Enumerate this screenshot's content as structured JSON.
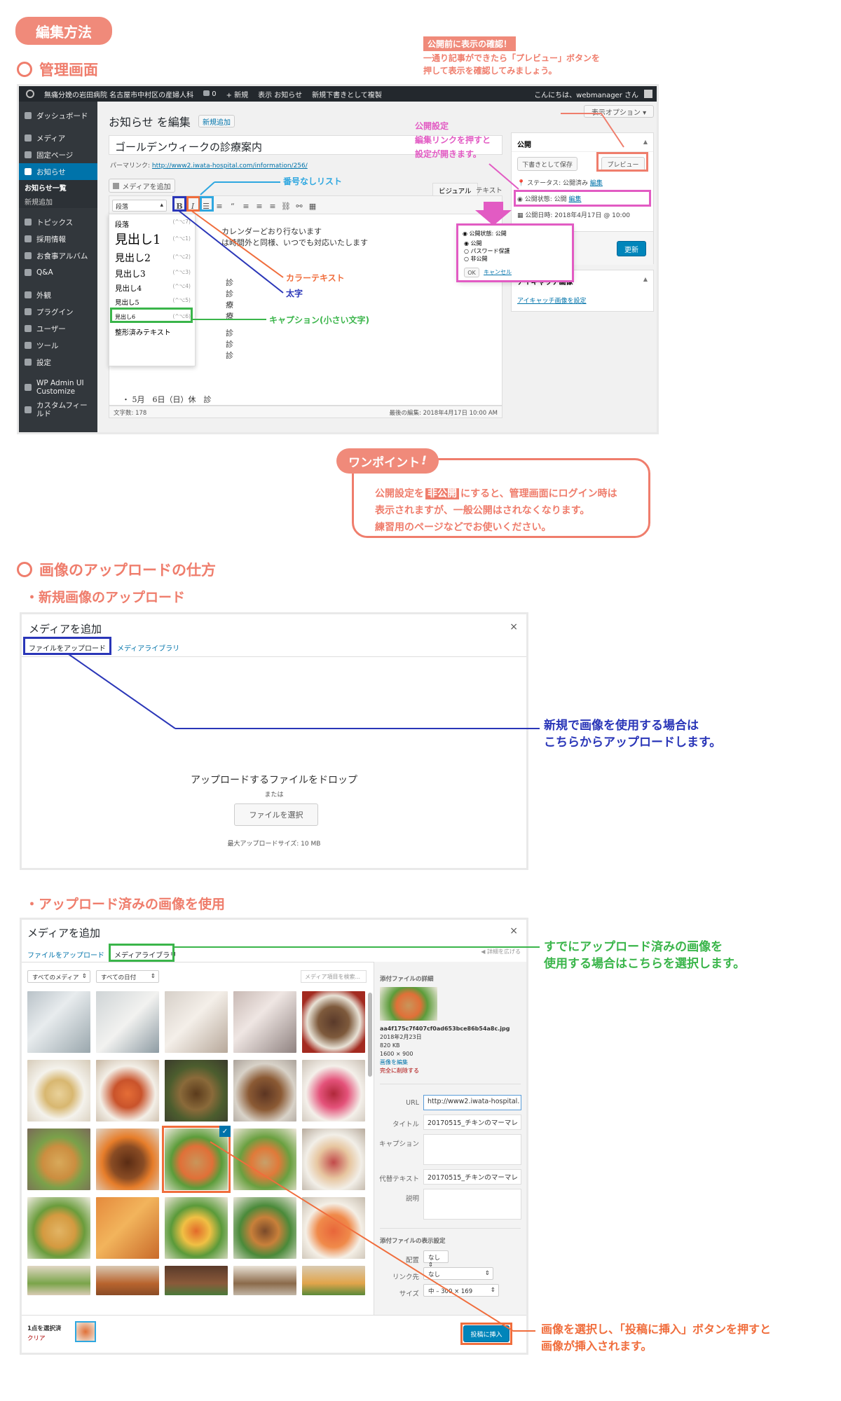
{
  "header": {
    "pill": "編集方法",
    "section1": "管理画面",
    "section2": "画像のアップロードの仕方",
    "sub1": "・新規画像のアップロード",
    "sub2": "・アップロード済みの画像を使用"
  },
  "notes": {
    "preview_title": "公開前に表示の確認！",
    "preview_body_1": "一通り記事ができたら「プレビュー」ボタンを",
    "preview_body_2": "押して表示を確認してみましょう。",
    "publish_1": "公開設定",
    "publish_2": "編集リンクを押すと",
    "publish_3": "設定が開きます。",
    "bullet_list": "番号なしリスト",
    "color_text": "カラーテキスト",
    "bold": "太字",
    "caption": "キャプション(小さい文字)",
    "onepoint_title": "ワンポイント",
    "onepoint_1a": "公開設定を",
    "onepoint_1b": "非公開",
    "onepoint_1c": "にすると、管理画面にログイン時は",
    "onepoint_2": "表示されますが、一般公開はされなくなります。",
    "onepoint_3": "練習用のページなどでお使いください。",
    "upload_note_1": "新規で画像を使用する場合は",
    "upload_note_2": "こちらからアップロードします。",
    "library_note_1": "すでにアップロード済みの画像を",
    "library_note_2": "使用する場合はこちらを選択します。",
    "insert_note_1": "画像を選択し、「投稿に挿入」ボタンを押すと",
    "insert_note_2": "画像が挿入されます。"
  },
  "admin": {
    "adminbar": {
      "site": "無痛分娩の岩田病院 名古屋市中村区の産婦人科",
      "comments": "0",
      "new": "+ 新規",
      "view": "表示 お知らせ",
      "draft": "新規下書きとして複製",
      "greeting": "こんにちは、webmanager さん"
    },
    "sidebar": [
      "ダッシュボード",
      "メディア",
      "固定ページ",
      "お知らせ",
      "お知らせ一覧",
      "新規追加",
      "トピックス",
      "採用情報",
      "お食事アルバム",
      "Q&A",
      "外観",
      "プラグイン",
      "ユーザー",
      "ツール",
      "設定",
      "WP Admin UI Customize",
      "カスタムフィールド"
    ],
    "screen_options": "表示オプション ▾",
    "page_title": "お知らせ を編集",
    "add_new": "新規追加",
    "post_title": "ゴールデンウィークの診療案内",
    "permalink_label": "パーマリンク:",
    "permalink_url": "http://www2.iwata-hospital.com/information/256/",
    "add_media": "メディアを追加",
    "tab_visual": "ビジュアル",
    "tab_text": "テキスト",
    "format_select": "段落",
    "format_items": [
      {
        "label": "段落",
        "key": "(^⌥7)"
      },
      {
        "label": "見出し1",
        "key": "(^⌥1)"
      },
      {
        "label": "見出し2",
        "key": "(^⌥2)"
      },
      {
        "label": "見出し3",
        "key": "(^⌥3)"
      },
      {
        "label": "見出し4",
        "key": "(^⌥4)"
      },
      {
        "label": "見出し5",
        "key": "(^⌥5)"
      },
      {
        "label": "見出し6",
        "key": "(^⌥6)"
      },
      {
        "label": "整形済みテキスト",
        "key": ""
      }
    ],
    "content_1": "カレンダーどおり行ないます",
    "content_2": "は時間外と同様、いつでも対応いたします",
    "content_last": "・ 5月　6日（日）休　診",
    "content_frag": [
      "診",
      "診",
      "療",
      "療",
      "診",
      "診",
      "診"
    ],
    "word_count": "文字数: 178",
    "last_edit": "最後の編集: 2018年4月17日 10:00 AM",
    "publish_box": {
      "title": "公開",
      "save_draft": "下書きとして保存",
      "preview": "プレビュー",
      "status": "ステータス: 公開済み",
      "edit": "編集",
      "visibility": "公開状態: 公開",
      "date": "公開日時: 2018年4月17日 @ 10:00",
      "update": "更新"
    },
    "popup": {
      "title": "公開状態: 公開",
      "opt1": "公開",
      "opt2": "パスワード保護",
      "opt3": "非公開",
      "ok": "OK",
      "cancel": "キャンセル"
    },
    "featured": {
      "title": "アイキャッチ画像",
      "link": "アイキャッチ画像を設定"
    }
  },
  "upload_modal": {
    "title": "メディアを追加",
    "close": "×",
    "tab_upload": "ファイルをアップロード",
    "tab_library": "メディアライブラリ",
    "drop": "アップロードするファイルをドロップ",
    "or": "または",
    "select": "ファイルを選択",
    "max": "最大アップロードサイズ: 10 MB"
  },
  "library_modal": {
    "title": "メディアを追加",
    "close": "×",
    "tab_upload": "ファイルをアップロード",
    "tab_library": "メディアライブラリ",
    "expand": "詳細を広げる",
    "filter_media": "すべてのメディア",
    "filter_date": "すべての日付",
    "search_placeholder": "メディア項目を検索...",
    "details_title": "添付ファイルの詳細",
    "filename": "aa4f175c7f407cf0ad653bce86b54a8c.jpg",
    "date": "2018年2月23日",
    "size": "820 KB",
    "dims": "1600 × 900",
    "edit_link": "画像を編集",
    "delete_link": "完全に削除する",
    "url_label": "URL",
    "url_value": "http://www2.iwata-hospital.",
    "title_label": "タイトル",
    "title_value": "20170515_チキンのマーマレ",
    "caption_label": "キャプション",
    "alt_label": "代替テキスト",
    "alt_value": "20170515_チキンのマーマレ",
    "desc_label": "説明",
    "display_title": "添付ファイルの表示設定",
    "align_label": "配置",
    "align_value": "なし",
    "link_label": "リンク先",
    "link_value": "なし",
    "size_label": "サイズ",
    "size_value": "中 – 300 × 169",
    "selected_count": "1点を選択済",
    "clear": "クリア",
    "insert": "投稿に挿入"
  },
  "colors": {
    "accent": "#ef7d6c",
    "blue": "#2a36b8",
    "green": "#3ab54a",
    "cyan": "#2ea7e0",
    "pink": "#e25bc3",
    "orange": "#f06d3c",
    "wp_blue": "#0085ba"
  }
}
